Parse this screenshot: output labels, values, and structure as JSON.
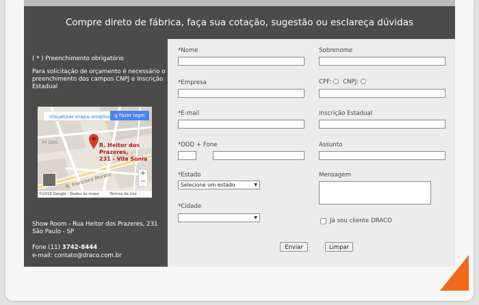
{
  "header": {
    "title": "Compre direto de fábrica, faça sua cotação, sugestão ou esclareça dúvidas"
  },
  "sidebar": {
    "required_note": "( * ) Preenchimento obrigatório",
    "quote_note": "Para solicitação de orçamento é necessário o preenchimento dos campos CNPJ e Inscrição Estadual",
    "map": {
      "search_label": "Visualizar mapa ampliado",
      "login_label": "Fazer login",
      "marker_line1": "R. Heitor dos Prazeres,",
      "marker_line2": "231 - Vila Sonia",
      "street_label": "R. Francisco Morato",
      "area_label": "IM DAS",
      "zoom_in": "+",
      "zoom_out": "−",
      "copyright": "©2015 Google - Dados do mapa",
      "terms": "Termos de Uso"
    },
    "address": "Show Room - Rua Heitor dos Prazeres, 231 São Paulo - SP",
    "phone_prefix": "Fone (11) ",
    "phone_number": "3742-8444",
    "email": "e-mail: contato@draco.com.br"
  },
  "form": {
    "nome_label": "*Nome",
    "sobrenome_label": "Sobrenome",
    "empresa_label": "*Empresa",
    "cpf_label": "CPF:",
    "cnpj_label": "CNPJ:",
    "email_label": "*E-mail",
    "inscricao_label": "Inscrição Estadual",
    "fone_label": "*DDD + Fone",
    "assunto_label": "Assunto",
    "estado_label": "*Estado",
    "estado_value": "Selecione um estado",
    "mensagem_label": "Mensagem",
    "cidade_label": "*Cidade",
    "cidade_value": "",
    "cliente_label": "Já sou cliente DRACO",
    "submit_label": "Enviar",
    "clear_label": "Limpar"
  },
  "colors": {
    "panel": "#4b4b4b",
    "form_bg": "#ececec",
    "accent": "#f26a1b",
    "map_marker": "#d33a2c",
    "map_button": "#4a84ee"
  }
}
